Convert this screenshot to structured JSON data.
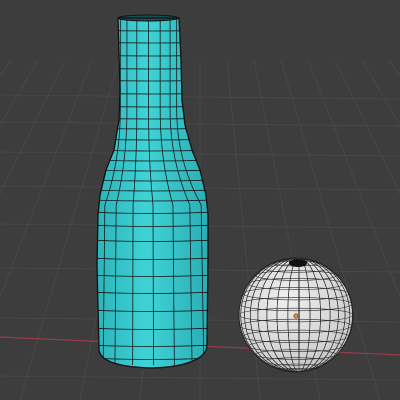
{
  "viewport": {
    "background": "#3d3d3d",
    "grid_color": "#4a4a4a",
    "x_axis_color": "#9a3b4a",
    "y_axis_color": "#6a8a2a"
  },
  "objects": [
    {
      "name": "bottle",
      "selected": true,
      "face_color": "#35c4c8",
      "wire_color": "#1a1a1a"
    },
    {
      "name": "sphere",
      "selected": false,
      "face_color": "#d6d6d6",
      "wire_color": "#2a2a2a",
      "origin_marker_color": "#e0902a"
    }
  ]
}
